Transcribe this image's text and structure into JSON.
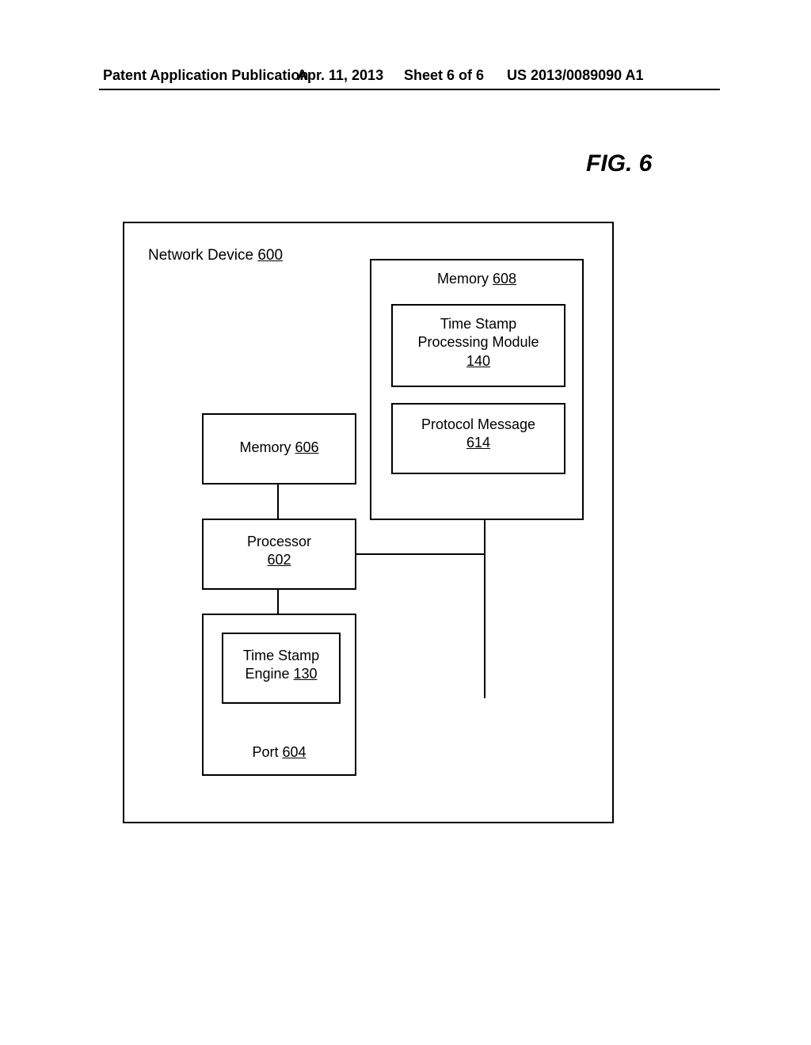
{
  "header": {
    "publication": "Patent Application Publication",
    "date": "Apr. 11, 2013",
    "sheet": "Sheet 6 of 6",
    "patent_no": "US 2013/0089090 A1"
  },
  "figure_title": "FIG. 6",
  "device": {
    "title_prefix": "Network Device ",
    "title_ref": "600"
  },
  "memory608": {
    "label_prefix": "Memory ",
    "ref": "608"
  },
  "tsmodule": {
    "line1": "Time Stamp",
    "line2": "Processing Module",
    "ref": "140"
  },
  "protomsg": {
    "label": "Protocol Message",
    "ref": "614"
  },
  "memory606": {
    "label_prefix": "Memory ",
    "ref": "606"
  },
  "processor": {
    "label": "Processor",
    "ref": "602"
  },
  "port": {
    "label_prefix": "Port ",
    "ref": "604"
  },
  "tsengine": {
    "line1": "Time Stamp",
    "line2_prefix": "Engine ",
    "ref": "130"
  }
}
